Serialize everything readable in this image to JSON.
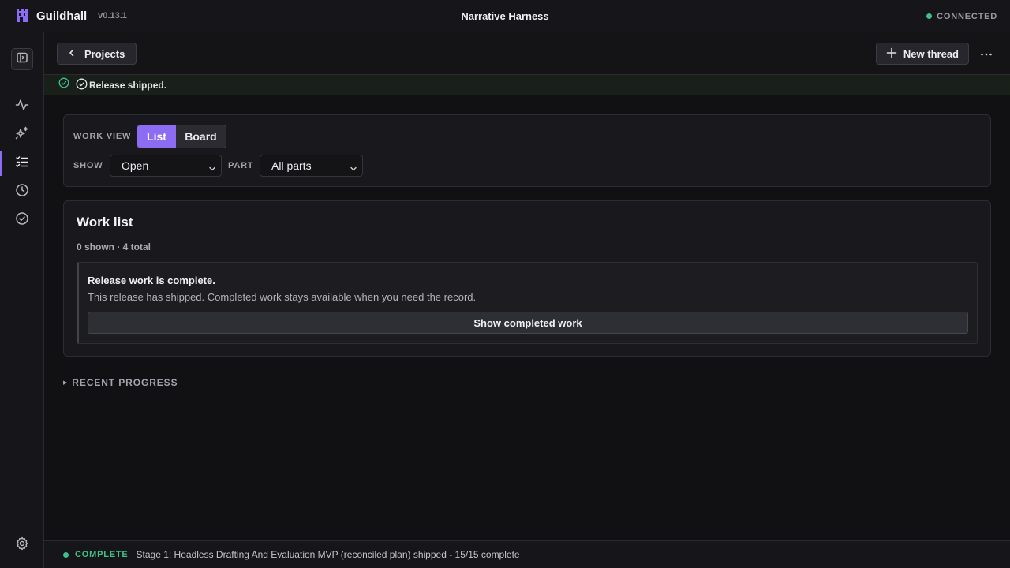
{
  "app": {
    "name": "Guildhall",
    "version": "v0.13.1",
    "window_title": "Narrative Harness",
    "connection_status": "CONNECTED",
    "accent_color": "#8b6cf2",
    "success_color": "#3fbf8a"
  },
  "sidebar": {
    "toggle_icon": "sidebar-toggle-icon",
    "items": [
      {
        "icon": "activity-icon",
        "active": false
      },
      {
        "icon": "sparkles-icon",
        "active": false
      },
      {
        "icon": "checklist-icon",
        "active": true
      },
      {
        "icon": "clock-icon",
        "active": false
      },
      {
        "icon": "check-circle-icon",
        "active": false
      }
    ],
    "settings_icon": "gear-icon"
  },
  "header": {
    "back_label": "Projects",
    "new_thread_label": "New thread"
  },
  "banner": {
    "text": "Release shipped."
  },
  "filters": {
    "work_view_label": "WORK VIEW",
    "view_options": [
      "List",
      "Board"
    ],
    "selected_view": "List",
    "show_label": "SHOW",
    "show_value": "Open",
    "part_label": "PART",
    "part_value": "All parts"
  },
  "work_list": {
    "title": "Work list",
    "count_text": "0 shown · 4 total",
    "notice_title": "Release work is complete.",
    "notice_body": "This release has shipped. Completed work stays available when you need the record.",
    "show_completed_label": "Show completed work"
  },
  "recent_progress": {
    "label": "RECENT PROGRESS"
  },
  "status_bar": {
    "tag": "COMPLETE",
    "text": "Stage 1: Headless Drafting And Evaluation MVP (reconciled plan) shipped - 15/15 complete"
  }
}
